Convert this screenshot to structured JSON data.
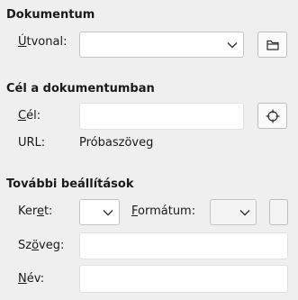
{
  "document": {
    "title": "Dokumentum",
    "path": {
      "label_mnemonic": "Ú",
      "label_rest": "tvonal:",
      "value": ""
    },
    "browse_icon": "folder-icon"
  },
  "target": {
    "title": "Cél a dokumentumban",
    "goal": {
      "label_mnemonic": "C",
      "label_rest": "él:",
      "value": ""
    },
    "target_icon": "crosshair-icon",
    "url_label": "URL:",
    "url_value": "Próbaszöveg"
  },
  "more": {
    "title": "További beállítások",
    "frame": {
      "label_pre": "Ker",
      "label_mnemonic": "e",
      "label_rest": "t:",
      "value": ""
    },
    "format": {
      "label_mnemonic": "F",
      "label_rest": "ormátum:",
      "value": ""
    },
    "text": {
      "label_pre": "Sz",
      "label_mnemonic": "ö",
      "label_rest": "veg:",
      "value": ""
    },
    "name": {
      "label_mnemonic": "N",
      "label_rest": "év:",
      "value": ""
    }
  }
}
